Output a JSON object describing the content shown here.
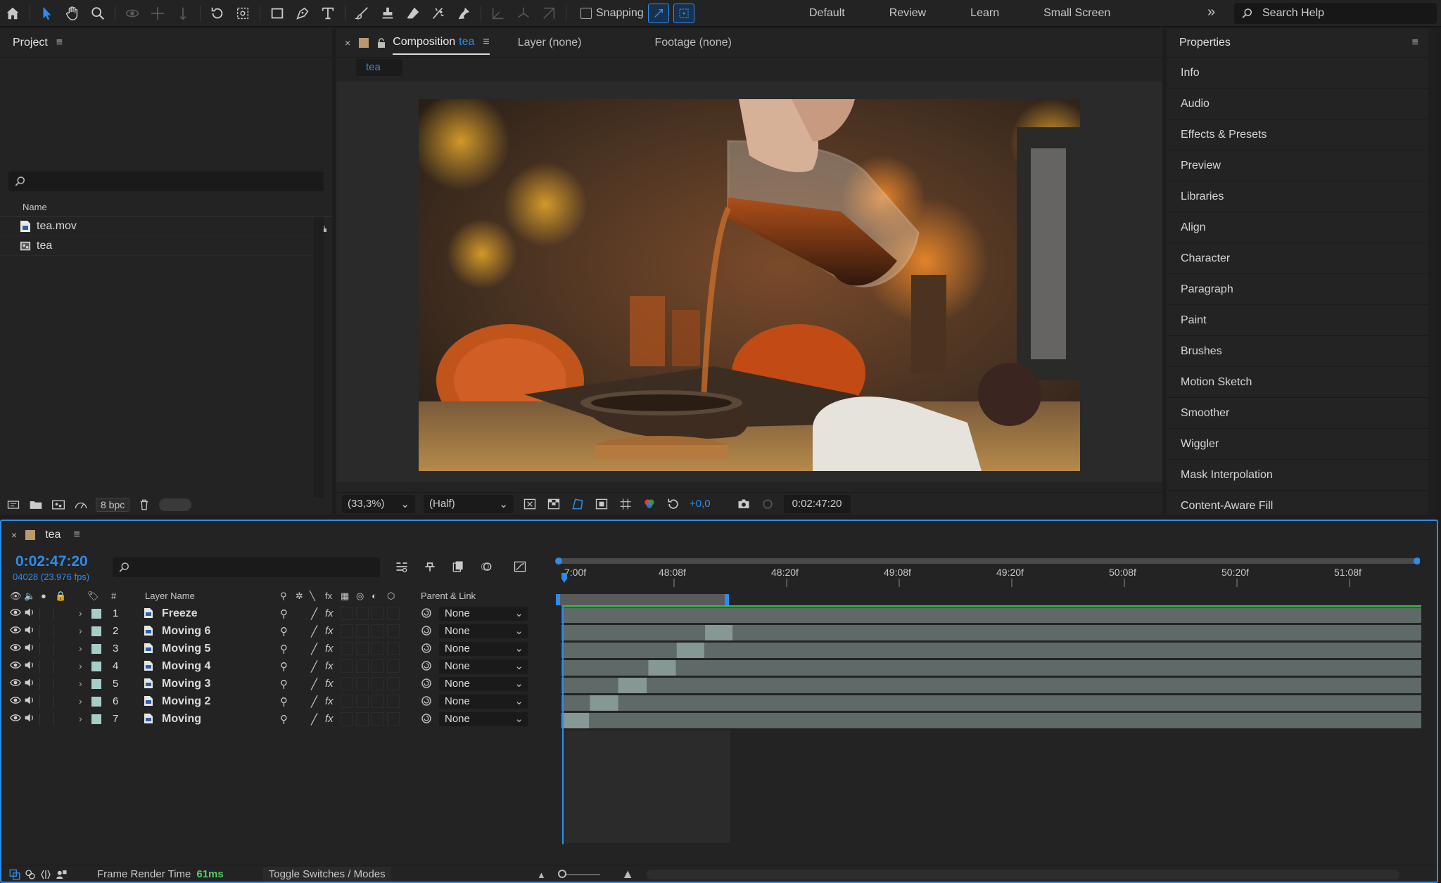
{
  "workspaces": [
    "Default",
    "Review",
    "Learn",
    "Small Screen"
  ],
  "snapping_label": "Snapping",
  "search_help_placeholder": "Search Help",
  "project": {
    "title": "Project",
    "column_name": "Name",
    "items": [
      {
        "name": "tea.mov",
        "icon": "footage-file-icon"
      },
      {
        "name": "tea",
        "icon": "composition-icon"
      }
    ],
    "bpc": "8 bpc"
  },
  "composition": {
    "tab_prefix": "Composition",
    "tab_name": "tea",
    "layer_tab": "Layer (none)",
    "footage_tab": "Footage (none)",
    "breadcrumb": "tea",
    "zoom": "(33,3%)",
    "resolution": "(Half)",
    "exposure": "+0,0",
    "timecode": "0:02:47:20"
  },
  "properties": {
    "title": "Properties",
    "items": [
      "Info",
      "Audio",
      "Effects & Presets",
      "Preview",
      "Libraries",
      "Align",
      "Character",
      "Paragraph",
      "Paint",
      "Brushes",
      "Motion Sketch",
      "Smoother",
      "Wiggler",
      "Mask Interpolation",
      "Content-Aware Fill"
    ]
  },
  "timeline": {
    "comp_name": "tea",
    "timecode": "0:02:47:20",
    "frame_info": "04028 (23.976 fps)",
    "columns": {
      "num": "#",
      "layer_name": "Layer Name",
      "parent": "Parent & Link"
    },
    "ruler": [
      "48:08f",
      "48:20f",
      "49:08f",
      "49:20f",
      "50:08f",
      "50:20f",
      "51:08f"
    ],
    "ruler_start": "7:00f",
    "layers": [
      {
        "num": "1",
        "name": "Freeze",
        "parent": "None",
        "start_frac": 0.0,
        "end_frac": 0.0
      },
      {
        "num": "2",
        "name": "Moving 6",
        "parent": "None",
        "start_frac": 0.167,
        "end_frac": 0.199
      },
      {
        "num": "3",
        "name": "Moving 5",
        "parent": "None",
        "start_frac": 0.134,
        "end_frac": 0.166
      },
      {
        "num": "4",
        "name": "Moving 4",
        "parent": "None",
        "start_frac": 0.101,
        "end_frac": 0.133
      },
      {
        "num": "5",
        "name": "Moving 3",
        "parent": "None",
        "start_frac": 0.066,
        "end_frac": 0.099
      },
      {
        "num": "6",
        "name": "Moving 2",
        "parent": "None",
        "start_frac": 0.033,
        "end_frac": 0.066
      },
      {
        "num": "7",
        "name": "Moving",
        "parent": "None",
        "start_frac": 0.0,
        "end_frac": 0.032
      }
    ],
    "frame_render_label": "Frame Render Time",
    "frame_render_value": "61ms",
    "toggle_label": "Toggle Switches / Modes"
  }
}
